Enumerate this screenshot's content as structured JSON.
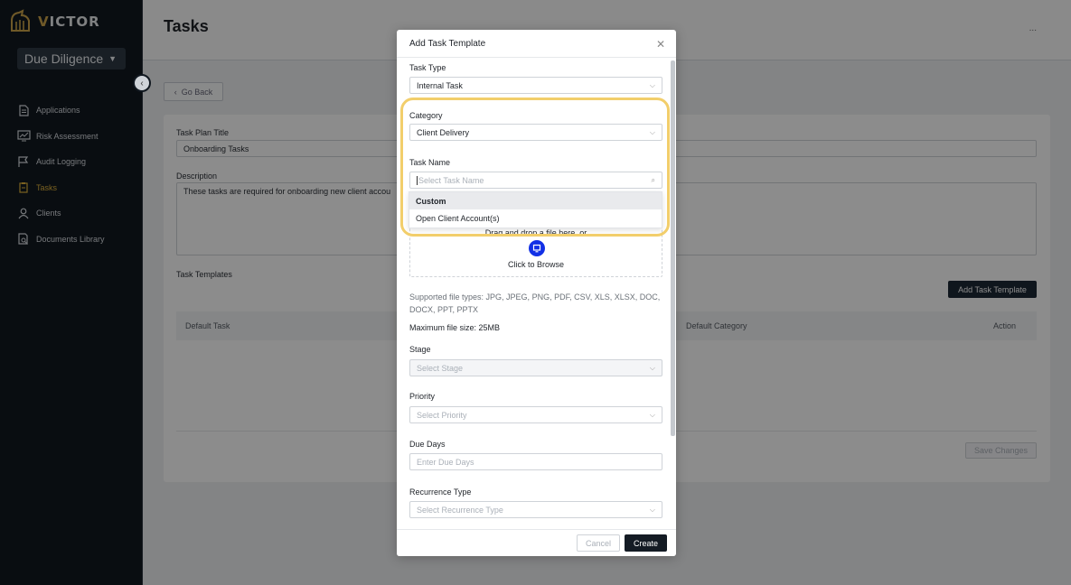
{
  "app": {
    "logo_text_a": "V",
    "logo_text_b": "ICTOR",
    "workspace": "Due Diligence"
  },
  "sidebar": {
    "items": [
      {
        "label": "Applications",
        "icon": "document-icon"
      },
      {
        "label": "Risk Assessment",
        "icon": "chart-icon"
      },
      {
        "label": "Audit Logging",
        "icon": "flag-icon"
      },
      {
        "label": "Tasks",
        "icon": "clipboard-icon",
        "active": true
      },
      {
        "label": "Clients",
        "icon": "user-icon"
      },
      {
        "label": "Documents Library",
        "icon": "doc-search-icon"
      }
    ]
  },
  "page": {
    "title": "Tasks",
    "more": "...",
    "go_back": "Go Back",
    "task_plan_title_label": "Task Plan Title",
    "task_plan_title_value": "Onboarding Tasks",
    "description_label": "Description",
    "description_value": "These tasks are required for onboarding new client accou",
    "task_templates_label": "Task Templates",
    "add_task_template": "Add Task Template",
    "columns": [
      "Default Task",
      "Default Category",
      "Action"
    ],
    "save_changes": "Save Changes"
  },
  "modal": {
    "title": "Add Task Template",
    "task_type_label": "Task Type",
    "task_type_value": "Internal Task",
    "category_label": "Category",
    "category_value": "Client Delivery",
    "task_name_label": "Task Name",
    "task_name_placeholder": "Select Task Name",
    "upload_drag": "Drag and drop a file here, or",
    "upload_browse": "Click to Browse",
    "supported_types": "Supported file types: JPG, JPEG, PNG, PDF, CSV, XLS, XLSX, DOC, DOCX, PPT, PPTX",
    "max_size": "Maximum file size: 25MB",
    "stage_label": "Stage",
    "stage_placeholder": "Select Stage",
    "priority_label": "Priority",
    "priority_placeholder": "Select Priority",
    "due_days_label": "Due Days",
    "due_days_placeholder": "Enter Due Days",
    "recurrence_label": "Recurrence Type",
    "recurrence_placeholder": "Select Recurrence Type",
    "cancel": "Cancel",
    "create": "Create",
    "dropdown_options": [
      "Custom",
      "Open Client Account(s)"
    ]
  },
  "colors": {
    "accent": "#e0b23c",
    "highlight": "#f2ce6b",
    "primary_button": "#141b24",
    "upload_icon": "#1230e6"
  }
}
